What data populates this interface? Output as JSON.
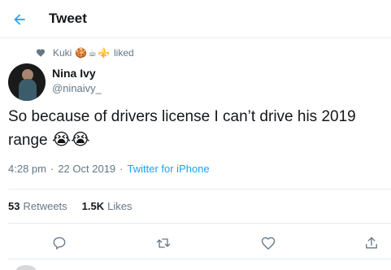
{
  "header": {
    "title": "Tweet",
    "back_icon": "arrow-left-icon"
  },
  "social_context": {
    "icon": "heart-icon",
    "name": "Kuki",
    "emojis": [
      "🍪",
      "☕",
      "⚜️"
    ],
    "verb": "liked"
  },
  "author": {
    "display_name": "Nina Ivy",
    "handle": "@ninaivy_"
  },
  "tweet": {
    "text": "So because of drivers license I can’t drive his 2019 range",
    "emojis": "😭😭"
  },
  "meta": {
    "time": "4:28 pm",
    "separator": "·",
    "date": "22 Oct 2019",
    "source": "Twitter for iPhone"
  },
  "stats": {
    "retweets_count": "53",
    "retweets_label": "Retweets",
    "likes_count": "1.5K",
    "likes_label": "Likes"
  },
  "actions": {
    "reply_icon": "reply-icon",
    "retweet_icon": "retweet-icon",
    "like_icon": "heart-outline-icon",
    "share_icon": "share-icon"
  },
  "colors": {
    "accent": "#1da1f2",
    "text_primary": "#14171a",
    "text_secondary": "#657786",
    "divider": "#e6ecf0"
  }
}
